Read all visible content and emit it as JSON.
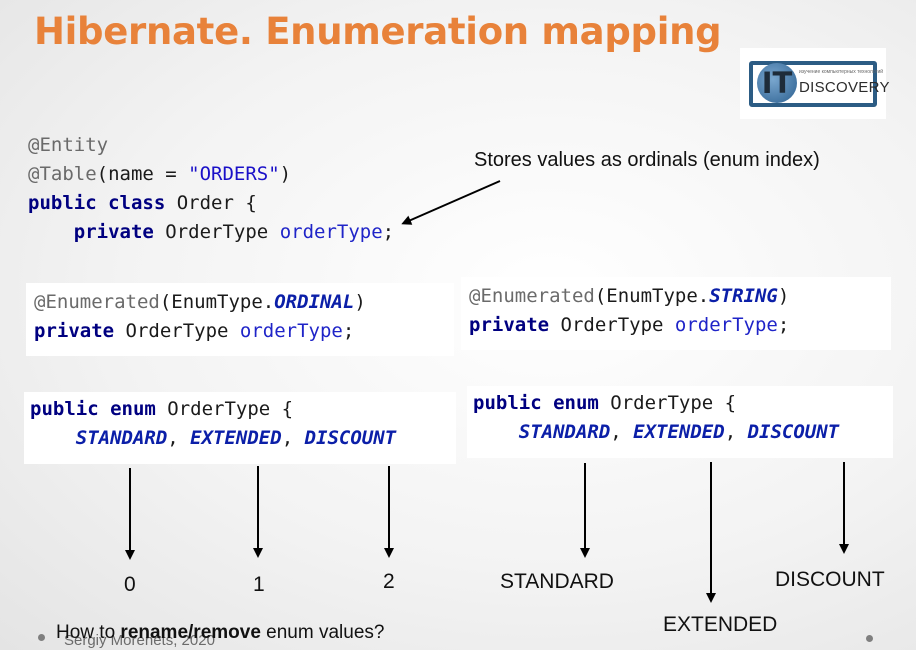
{
  "title": "Hibernate. Enumeration mapping",
  "logo": {
    "letters": "IT",
    "name": "DISCOVERY",
    "tagline": "изучение компьютерных технологий"
  },
  "callout": "Stores values as ordinals (enum index)",
  "entity_code": {
    "line1": "@Entity",
    "line2_ann": "@Table",
    "line2_open": "(name = ",
    "line2_str": "\"ORDERS\"",
    "line2_close": ")",
    "line3_kw": "public class",
    "line3_rest": " Order {",
    "line4_kw": "private",
    "line4_type": " OrderType ",
    "line4_field": "orderType",
    "line4_end": ";"
  },
  "ordinal_block": {
    "ann": "@Enumerated",
    "open": "(EnumType.",
    "value": "ORDINAL",
    "close": ")",
    "kw": "private",
    "type": " OrderType ",
    "field": "orderType",
    "end": ";"
  },
  "string_block": {
    "ann": "@Enumerated",
    "open": "(EnumType.",
    "value": "STRING",
    "close": ")",
    "kw": "private",
    "type": " OrderType ",
    "field": "orderType",
    "end": ";"
  },
  "enum_decl": {
    "kw": "public enum",
    "name": " OrderType {",
    "values": [
      "STANDARD",
      "EXTENDED",
      "DISCOUNT"
    ],
    "sep": ", "
  },
  "ordinal_values": [
    "0",
    "1",
    "2"
  ],
  "string_values": [
    "STANDARD",
    "EXTENDED",
    "DISCOUNT"
  ],
  "footer": {
    "question_pre": "How to ",
    "question_bold": "rename/remove",
    "question_post": " enum values?",
    "author": "Sergiy Morenets, 2020"
  }
}
